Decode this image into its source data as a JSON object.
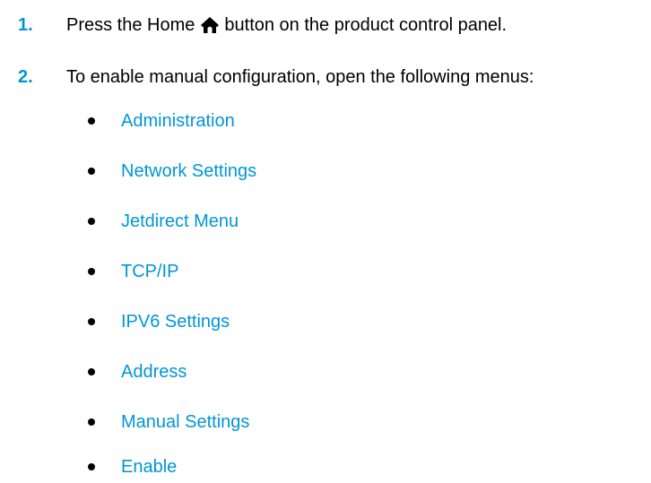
{
  "steps": [
    {
      "number": "1.",
      "text_before": "Press the Home",
      "icon": "home-icon",
      "text_after": "button on the product control panel."
    },
    {
      "number": "2.",
      "text": "To enable manual configuration, open the following menus:"
    }
  ],
  "menus": [
    "Administration",
    "Network Settings",
    "Jetdirect Menu",
    "TCP/IP",
    "IPV6 Settings",
    "Address",
    "Manual Settings",
    "Enable"
  ],
  "colors": {
    "accent": "#0096d6",
    "text": "#000000"
  }
}
